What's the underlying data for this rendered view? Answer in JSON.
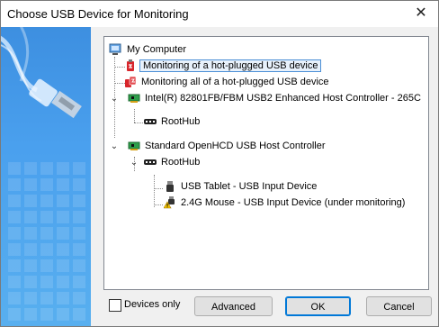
{
  "window": {
    "title": "Choose USB Device for Monitoring"
  },
  "tree": {
    "root": "My Computer",
    "items": [
      {
        "label": "Monitoring of a hot-plugged USB device",
        "icon": "usb-plug-red-icon",
        "selected": true
      },
      {
        "label": "Monitoring all of a hot-plugged USB device",
        "icon": "usb-plug-multi-icon"
      },
      {
        "label": "Intel(R) 82801FB/FBM USB2 Enhanced Host Controller - 265C",
        "icon": "pci-card-icon",
        "expanded": true
      },
      {
        "label": "RootHub",
        "icon": "hub-icon"
      },
      {
        "label": "Standard OpenHCD USB Host Controller",
        "icon": "pci-card-icon",
        "expanded": true
      },
      {
        "label": "RootHub",
        "icon": "hub-icon",
        "expanded": true
      },
      {
        "label": "USB Tablet - USB Input Device",
        "icon": "usb-device-icon"
      },
      {
        "label": "2.4G Mouse - USB Input Device (under monitoring)",
        "icon": "usb-device-warning-icon"
      }
    ]
  },
  "options": {
    "devices_only_label": "Devices only",
    "devices_only_checked": false
  },
  "buttons": {
    "advanced": "Advanced",
    "ok": "OK",
    "cancel": "Cancel"
  },
  "colors": {
    "banner": "#4aa0ee",
    "selection_border": "#4c8fd6",
    "default_button": "#0078d7"
  }
}
